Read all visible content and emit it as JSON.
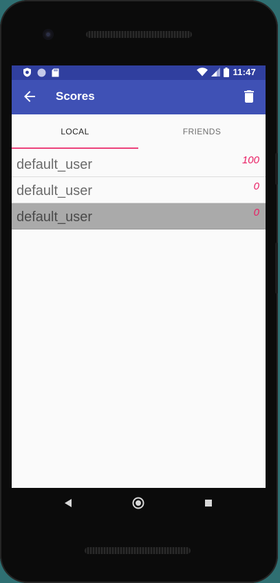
{
  "status_bar": {
    "time": "11:47",
    "left_icons": [
      "shield-icon",
      "circle-icon",
      "sd-card-icon"
    ],
    "right_icons": [
      "wifi-icon",
      "cell-signal-icon",
      "battery-icon"
    ]
  },
  "app_bar": {
    "title": "Scores",
    "back_icon": "arrow-back-icon",
    "action_icon": "trash-icon"
  },
  "tabs": [
    {
      "label": "LOCAL",
      "selected": true
    },
    {
      "label": "FRIENDS",
      "selected": false
    }
  ],
  "scores": [
    {
      "name": "default_user",
      "score": "100",
      "selected": false
    },
    {
      "name": "default_user",
      "score": "0",
      "selected": false
    },
    {
      "name": "default_user",
      "score": "0",
      "selected": true
    }
  ],
  "nav_bar": {
    "buttons": [
      "back-triangle-icon",
      "home-circle-icon",
      "recents-square-icon"
    ]
  },
  "colors": {
    "status_bar": "#303f9f",
    "app_bar": "#3f51b5",
    "accent": "#e91e63",
    "tab_indicator": "#ec407a",
    "selected_row": "#aaaaaa"
  }
}
